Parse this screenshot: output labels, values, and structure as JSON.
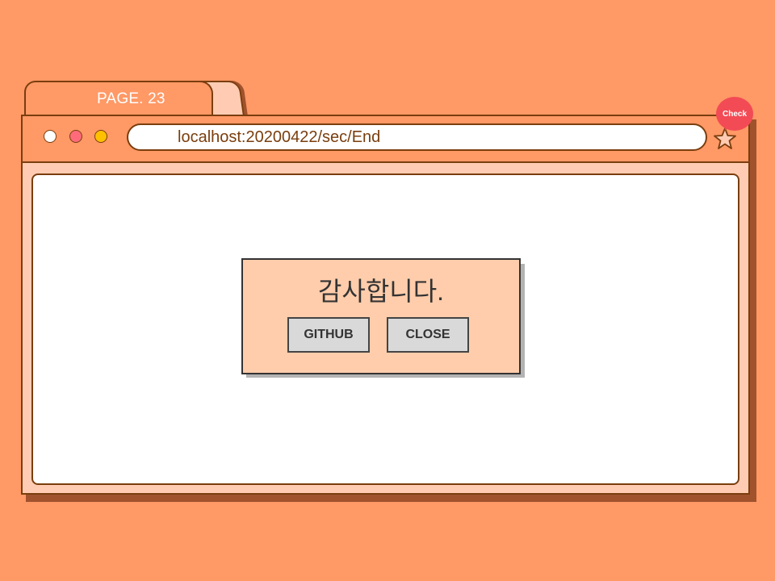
{
  "browser": {
    "tab_label": "PAGE. 23",
    "url": "localhost:20200422/sec/End",
    "check_badge": "Check",
    "traffic_lights": [
      {
        "name": "white",
        "color": "#ffffff"
      },
      {
        "name": "pink",
        "color": "#ff6b7a"
      },
      {
        "name": "yellow",
        "color": "#ffc000"
      }
    ],
    "bookmark_icon": "star-icon"
  },
  "dialog": {
    "message": "감사합니다.",
    "buttons": {
      "github_label": "GITHUB",
      "close_label": "CLOSE"
    }
  },
  "colors": {
    "background": "#ff9966",
    "outline": "#7a3e0e",
    "badge": "#f24b55",
    "dialog_bg": "#ffcdab"
  }
}
